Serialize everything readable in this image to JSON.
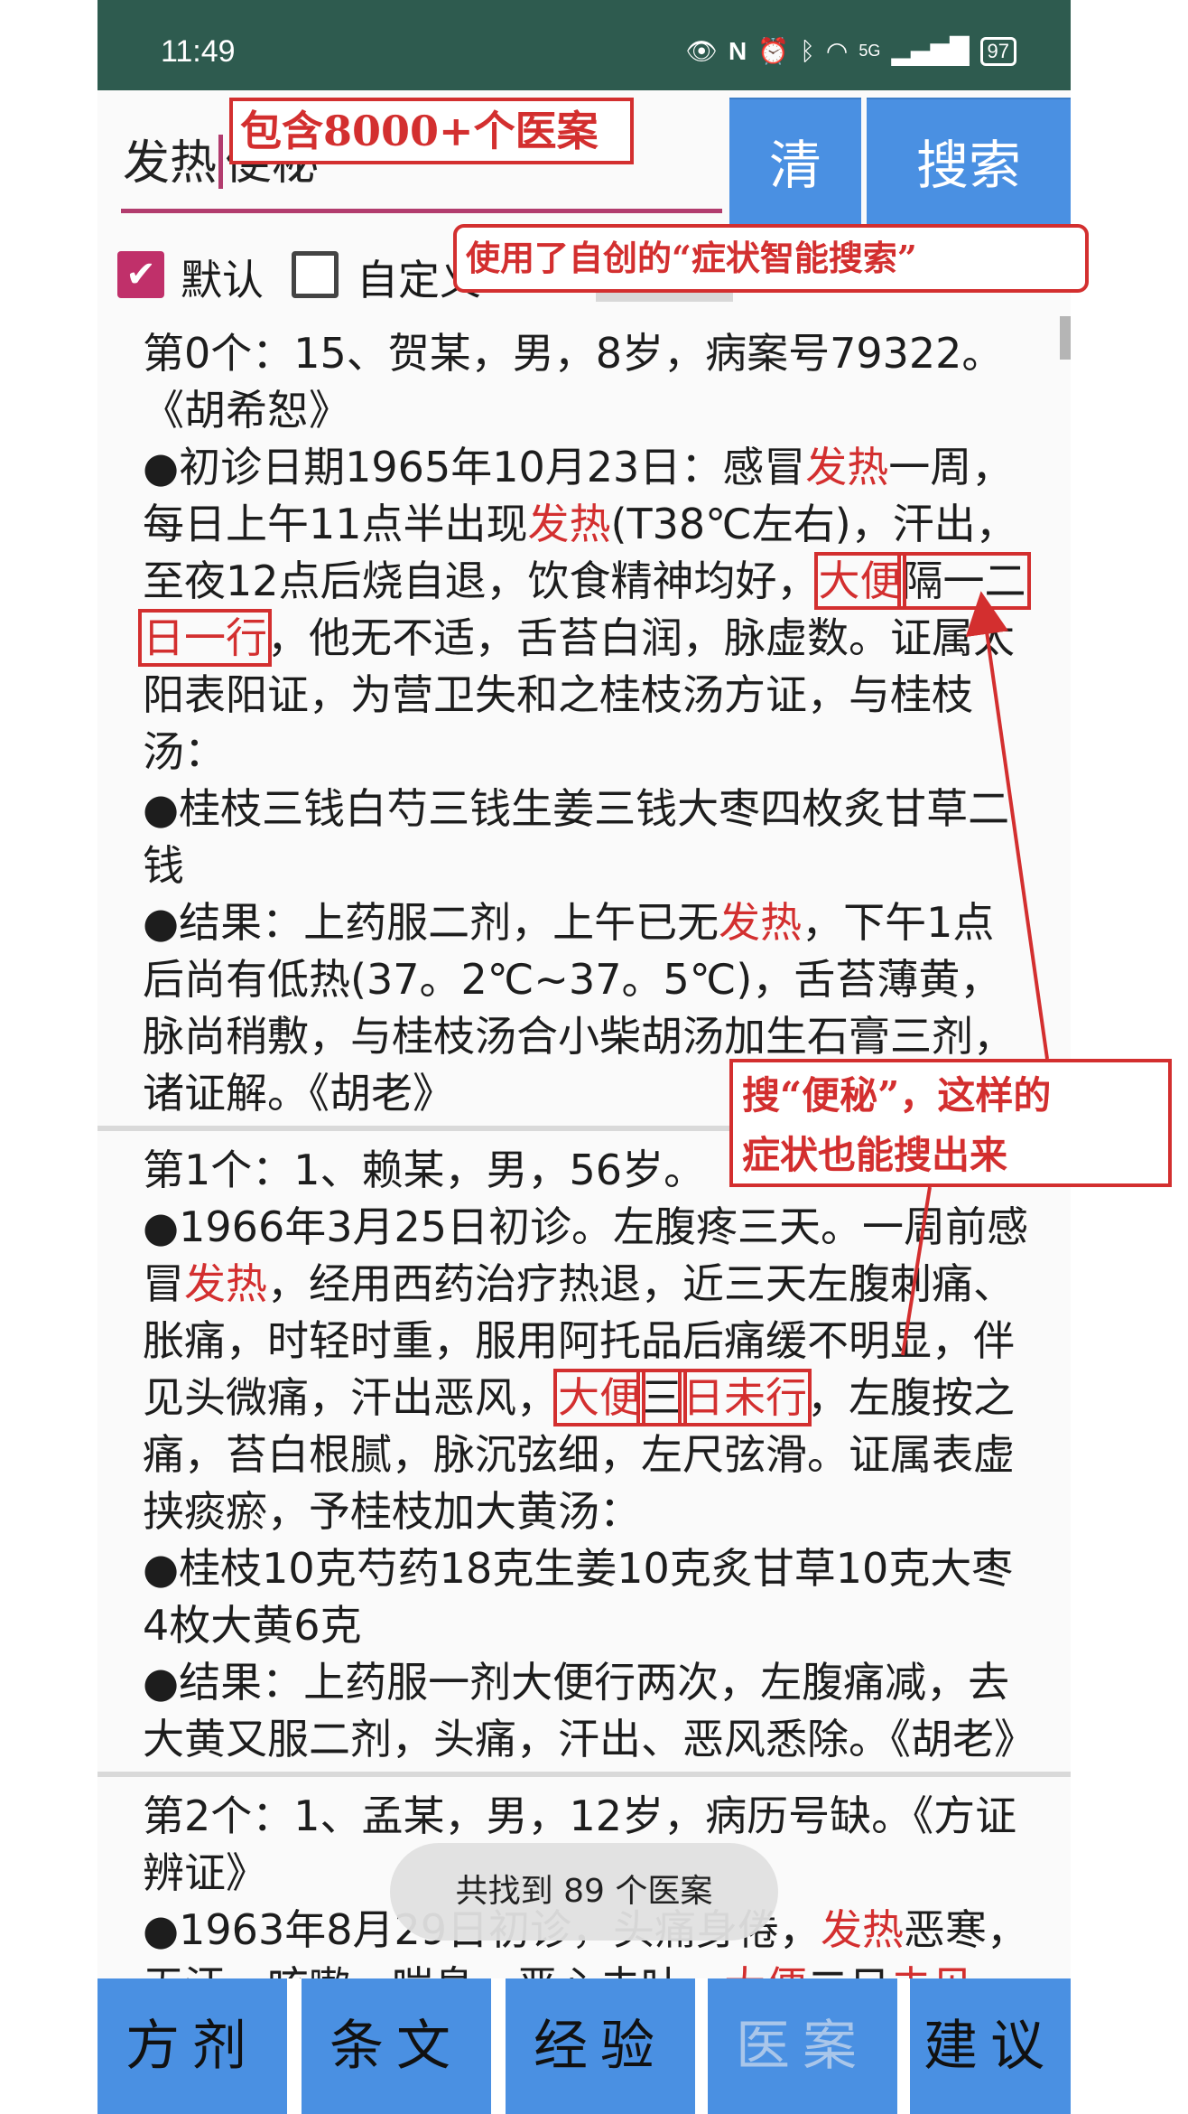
{
  "status_bar": {
    "time": "11:49",
    "icons": [
      "eye-icon",
      "nfc-icon",
      "alarm-icon",
      "bluetooth-icon",
      "wifi-icon",
      "signal-icon"
    ],
    "network": "5G",
    "battery": "97"
  },
  "search": {
    "query_part1": "发热",
    "query_part2": "便秘",
    "clear_label": "清",
    "search_label": "搜索"
  },
  "options": {
    "default_label": "默认",
    "default_checked": true,
    "custom_label": "自定义",
    "custom_checked": false,
    "add_label": "+"
  },
  "annotations": {
    "count_note": "包含8000+个医案",
    "smart_search_note": "使用了自创的“症状智能搜索”",
    "constipation_note_line1": "搜“便秘”，这样的",
    "constipation_note_line2": "症状也能搜出来"
  },
  "results": [
    {
      "header": "第0个：15、贺某，男，8岁，病案号79322。《胡希恕》",
      "p1": {
        "a": "●初诊日期1965年10月23日：感冒",
        "b": "发热",
        "c": "一周，每日上午11点半出现",
        "d": "发热",
        "e": "(T38℃左右)，汗出，至夜12点后烧自退，饮食精神均好，",
        "f": "大便",
        "g": "隔一二",
        "h": "日一行",
        "i": "，他无不适，舌苔白润，脉虚数。证属太阳表阳证，为营卫失和之桂枝汤方证，与桂枝汤："
      },
      "p2": "●桂枝三钱白芍三钱生姜三钱大枣四枚炙甘草二钱",
      "p3": {
        "a": "●结果：上药服二剂，上午已无",
        "b": "发热",
        "c": "，下午1点后尚有低热(37。2℃~37。5℃)，舌苔薄黄，脉尚稍敷，与桂枝汤合小柴胡汤加生石膏三剂，诸证解。《胡老》"
      }
    },
    {
      "header": "第1个：1、赖某，男，56岁。",
      "p1": {
        "a": "●1966年3月25日初诊。左腹疼三天。一周前感冒",
        "b": "发热",
        "c": "，经用西药治疗热退，近三天左腹刺痛、胀痛，时轻时重，服用阿托品后痛缓不明显，伴见头微痛，汗出恶风，",
        "d": "大便",
        "e": "三",
        "f": "日未行",
        "g": "，左腹按之痛，苔白根腻，脉沉弦细，左尺弦滑。证属表虚挟痰瘀，予桂枝加大黄汤："
      },
      "p2": "●桂枝10克芍药18克生姜10克炙甘草10克大枣4枚大黄6克",
      "p3": "●结果：上药服一剂大便行两次，左腹痛减，去大黄又服二剂，头痛，汗出、恶风悉除。《胡老》"
    },
    {
      "header": "第2个：1、孟某，男，12岁，病历号缺。《方证辨证》",
      "p1": {
        "a": "●1963年8月29日初诊，头痛身倦，",
        "b": "发热",
        "c": "恶寒，无汗，咳嗽，喘息，恶心未吐，",
        "d": "大便",
        "e": "二日",
        "f": "未见",
        "g": "，"
      }
    }
  ],
  "toast": "共找到 89 个医案",
  "bottom_nav": [
    {
      "label": "方剂",
      "active": true
    },
    {
      "label": "条文",
      "active": true
    },
    {
      "label": "经验",
      "active": true
    },
    {
      "label": "医案",
      "active": false
    },
    {
      "label": "建议",
      "active": true
    }
  ],
  "colors": {
    "status_bar": "#2e5b4f",
    "accent_blue": "#4a90e2",
    "highlight_red": "#d32f2f",
    "checkbox": "#c0306a"
  }
}
